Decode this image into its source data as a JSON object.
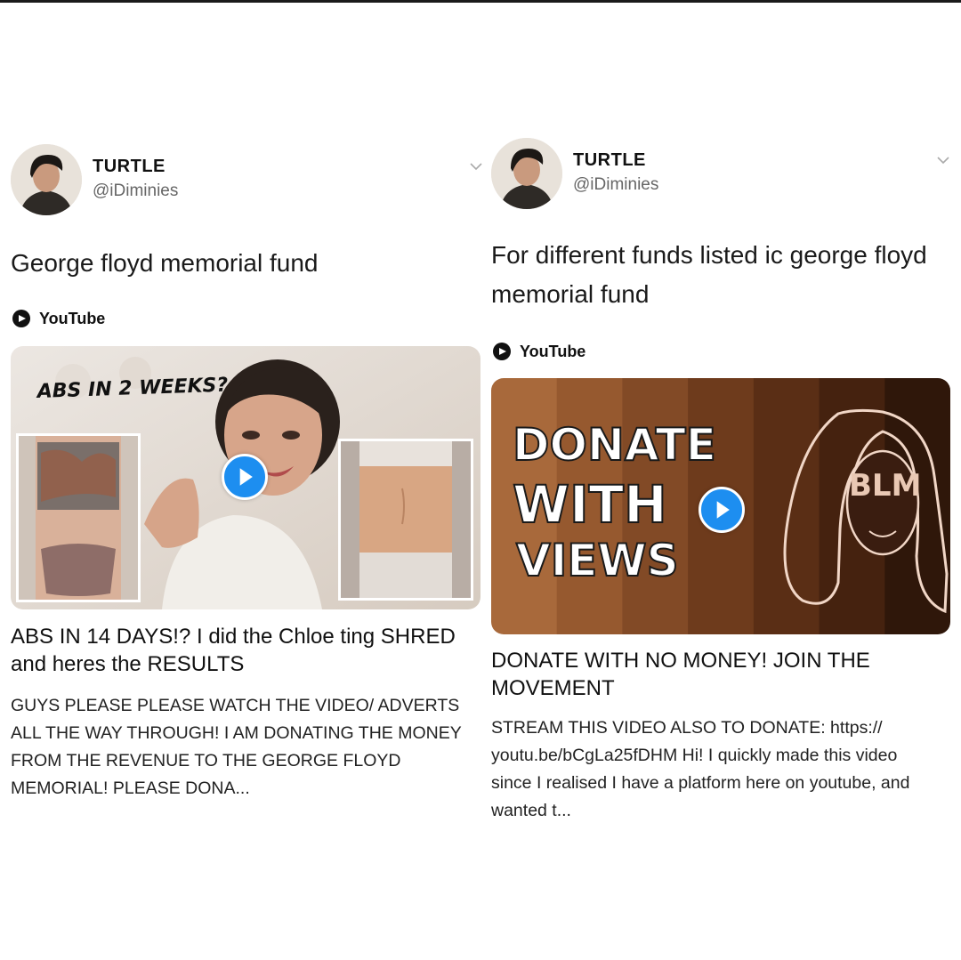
{
  "tweets": [
    {
      "display_name": "TURTLE",
      "handle": "@iDiminies",
      "text": "George floyd memorial fund",
      "source_label": "YouTube",
      "thumbnail": {
        "caption": "ABS IN 2 WEEKS?"
      },
      "card_title": "ABS IN 14 DAYS!? I did the Chloe ting SHRED and heres the RESULTS",
      "card_description": "GUYS PLEASE PLEASE WATCH THE VIDEO/ ADVERTS ALL THE WAY THROUGH! I AM DONATING THE MONEY FROM THE REVENUE TO THE GEORGE FLOYD MEMORIAL! PLEASE DONA..."
    },
    {
      "display_name": "TURTLE",
      "handle": "@iDiminies",
      "text": "For different funds listed ic george floyd memorial fund",
      "source_label": "YouTube",
      "thumbnail": {
        "line1": "DONATE",
        "line2": "WITH",
        "line3": "VIEWS",
        "badge": "BLM"
      },
      "card_title": "DONATE WITH NO MONEY! JOIN THE MOVEMENT",
      "card_description": "STREAM THIS VIDEO ALSO TO DONATE: https:// youtu.be/bCgLa25fDHM Hi! I quickly made this video since I realised I have a platform here on youtube, and wanted t..."
    }
  ],
  "colors": {
    "play_button": "#1d8ef0",
    "handle": "#666666",
    "stripes": [
      "#a8693b",
      "#96592f",
      "#824a26",
      "#6e3b1c",
      "#5a2e15",
      "#45220f",
      "#2f170a"
    ]
  },
  "icons": [
    "chevron-down-icon",
    "youtube-icon",
    "play-icon"
  ]
}
